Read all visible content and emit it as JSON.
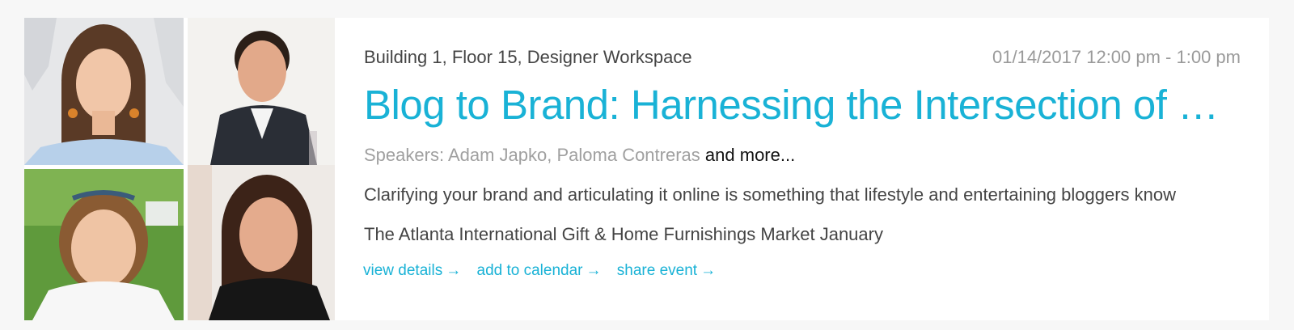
{
  "event": {
    "location": "Building 1, Floor 15, Designer Workspace",
    "datetime": "01/14/2017 12:00 pm - 1:00 pm",
    "title": "Blog to Brand: Harnessing the Intersection of Online",
    "speakers_label": "Speakers:",
    "speakers_names": "Adam Japko, Paloma Contreras",
    "speakers_more": "and more...",
    "description": "Clarifying your brand and articulating it online is something that lifestyle and entertaining bloggers know",
    "market": "The Atlanta International Gift & Home Furnishings Market January"
  },
  "actions": [
    {
      "label": "view details",
      "icon": "arrow-right-icon",
      "glyph": "→"
    },
    {
      "label": "add to calendar",
      "icon": "arrow-right-icon",
      "glyph": "→"
    },
    {
      "label": "share event",
      "icon": "arrow-right-icon",
      "glyph": "→"
    }
  ],
  "photos": [
    {
      "name": "speaker-photo-1"
    },
    {
      "name": "speaker-photo-2"
    },
    {
      "name": "speaker-photo-3"
    },
    {
      "name": "speaker-photo-4"
    }
  ],
  "colors": {
    "accent": "#19b2d6",
    "text": "#444444",
    "muted": "#9a9a9a",
    "background": "#f7f7f7",
    "card": "#ffffff"
  }
}
